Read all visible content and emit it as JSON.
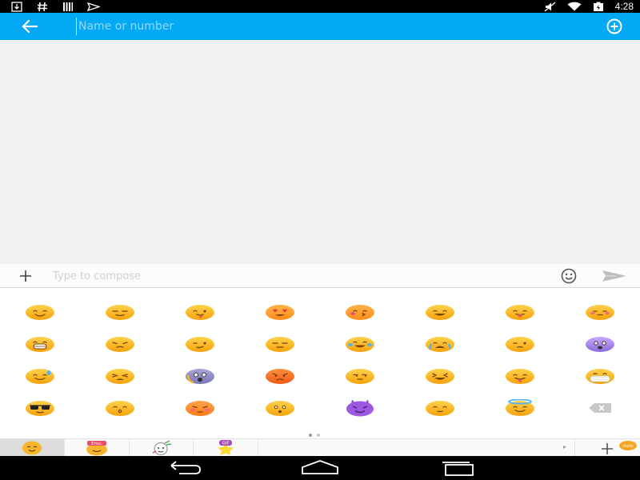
{
  "status_bar": {
    "time": "4:28",
    "left_icons": [
      "download-icon",
      "hash-icon",
      "barcode-icon",
      "paper-plane-icon"
    ],
    "right_icons": [
      "mute-icon",
      "wifi-icon",
      "battery-icon"
    ]
  },
  "action_bar": {
    "background": "#03a9f4",
    "back_icon": "back-arrow-icon",
    "recipient_placeholder": "Name or number",
    "add_contact_icon": "add-circle-icon"
  },
  "compose_bar": {
    "attach_icon": "plus-icon",
    "placeholder": "Type to compose",
    "emoji_icon": "smiley-icon",
    "send_icon": "send-icon"
  },
  "emoji_keyboard": {
    "rows": [
      [
        "smile",
        "relieved",
        "wink-tongue",
        "heart-eyes",
        "kiss-blush",
        "grin",
        "tongue-out",
        "blush-shy"
      ],
      [
        "grin-wide",
        "pensive",
        "smirk-eye",
        "expressionless",
        "tears-of-joy",
        "sob",
        "sleepy-eye",
        "fearful-blue"
      ],
      [
        "sweat-smile",
        "tired",
        "scream",
        "angry",
        "unamused",
        "laughing",
        "stuck-out-tongue",
        "mask"
      ],
      [
        "sunglasses",
        "kissing-closed",
        "flushed-angry",
        "astonished",
        "devil",
        "neutral",
        "halo",
        "delete-key"
      ]
    ],
    "pages": 2,
    "current_page": 1
  },
  "category_bar": {
    "tabs": [
      "emoji-smiley-category",
      "emoji-text-category",
      "sticker-category",
      "gif-category"
    ],
    "tab_labels": [
      "",
      "Emo.",
      "",
      "GIF"
    ],
    "active_index": 0,
    "add_label": "more"
  },
  "nav_bar": {
    "buttons": [
      "back-nav-icon",
      "home-nav-icon",
      "recents-nav-icon"
    ]
  }
}
